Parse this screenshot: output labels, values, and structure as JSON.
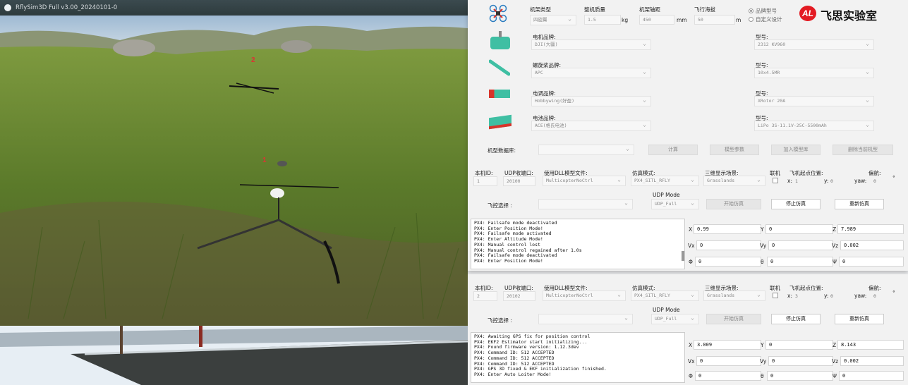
{
  "sim": {
    "title": "RflySim3D Full v3.00_20240101-0",
    "marker_1": "1",
    "marker_2": "2"
  },
  "cfg": {
    "frame_type_label": "机架类型",
    "frame_type_value": "四旋翼",
    "mass_label": "整机质量",
    "mass_value": "1.5",
    "mass_unit": "kg",
    "wheelbase_label": "机架轴距",
    "wheelbase_value": "450",
    "wheelbase_unit": "mm",
    "altitude_label": "飞行海拔",
    "altitude_value": "50",
    "altitude_unit": "m",
    "radio_brand": "品牌型号",
    "radio_custom": "自定义设计",
    "brand_logo": "飞思实验室",
    "motor_brand_label": "电机品牌:",
    "motor_brand_value": "DJI(大疆)",
    "motor_model_label": "型号:",
    "motor_model_value": "2312 KV960",
    "prop_brand_label": "螺旋桨品牌:",
    "prop_brand_value": "APC",
    "prop_model_label": "型号:",
    "prop_model_value": "10x4.5MR",
    "esc_brand_label": "电调品牌:",
    "esc_brand_value": "Hobbywing(好盈)",
    "esc_model_label": "型号:",
    "esc_model_value": "XRotor 20A",
    "bat_brand_label": "电池品牌:",
    "bat_brand_value": "ACE(格氏电池)",
    "bat_model_label": "型号:",
    "bat_model_value": "LiPo 3S-11.1V-25C-5500mAh",
    "db_label": "机型数据库:",
    "calc_btn": "计算",
    "params_btn": "模型参数",
    "add_btn": "加入模型库",
    "del_btn": "删除当前机型"
  },
  "panel_headers": {
    "id": "本机ID:",
    "udp_port": "UDP收端口:",
    "dll": "使用DLL模型文件:",
    "sim_mode": "仿真模式:",
    "scene": "三维显示场景:",
    "link": "联机",
    "start_pos": "飞机起点位置:",
    "yaw_hdr": "偏航:",
    "x_lbl": "x:",
    "y_lbl": "y:",
    "yaw_lbl": "yaw:",
    "udp_mode": "UDP Mode",
    "fc_select": "飞控选择 :",
    "start_btn": "开始仿真",
    "stop_btn": "停止仿真",
    "restart_btn": "重新仿真",
    "x_box": "X",
    "y_box": "Y",
    "z_box": "Z",
    "vx_box": "Vx",
    "vy_box": "Vy",
    "vz_box": "Vz",
    "phi_box": "Φ",
    "theta_box": "θ",
    "psi_box": "Ψ",
    "deg": "°"
  },
  "panel1": {
    "id": "1",
    "port": "20100",
    "dll": "MulticopterNoCtrl",
    "mode": "PX4_SITL_RFLY",
    "scene": "Grasslands",
    "x": "1",
    "y": "0",
    "yaw": "0",
    "udp": "UDP_Full",
    "log": "PX4: Failsafe mode deactivated\nPX4: Enter Position Mode!\nPX4: Failsafe mode activated\nPX4: Enter Altitude Mode!\nPX4: Manual control lost\nPX4: Manual control regained after 1.0s\nPX4: Failsafe mode deactivated\nPX4: Enter Position Mode!",
    "X": "0.99",
    "Y": "0",
    "Z": "7.989",
    "Vx": "0",
    "Vy": "0",
    "Vz": "0.002",
    "Phi": "0",
    "Theta": "0",
    "Psi": "0"
  },
  "panel2": {
    "id": "2",
    "port": "20102",
    "dll": "MulticopterNoCtrl",
    "mode": "PX4_SITL_RFLY",
    "scene": "Grasslands",
    "x": "3",
    "y": "0",
    "yaw": "0",
    "udp": "UDP_Full",
    "log": "PX4: Awaiting GPS fix for position control\nPX4: EKF2 Estimator start initializing...\nPX4: Found firmware version: 1.12.3dev\nPX4: Command ID: 512 ACCEPTED\nPX4: Command ID: 512 ACCEPTED\nPX4: Command ID: 512 ACCEPTED\nPX4: GPS 3D fixed & EKF initialization finished.\nPX4: Enter Auto Loiter Mode!",
    "X": "3.009",
    "Y": "0",
    "Z": "8.143",
    "Vx": "0",
    "Vy": "0",
    "Vz": "0.002",
    "Phi": "0",
    "Theta": "0",
    "Psi": "0"
  },
  "colors": {
    "brand_red": "#e31b23",
    "grass": "#5c7a2c",
    "sky": "#a9c6df"
  }
}
